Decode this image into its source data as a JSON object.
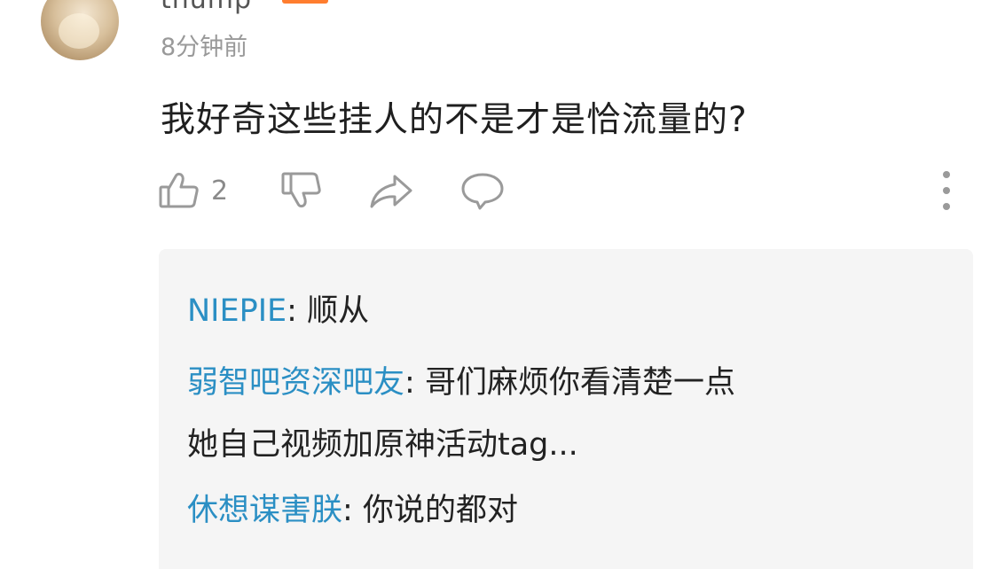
{
  "comment": {
    "username": "thump",
    "timestamp": "8分钟前",
    "text": "我好奇这些挂人的不是才是恰流量的?",
    "like_count": "2",
    "badge_color": "#ff7d2f"
  },
  "actions": {
    "like_icon": "thumbs-up-icon",
    "dislike_icon": "thumbs-down-icon",
    "share_icon": "share-icon",
    "reply_icon": "comment-bubble-icon",
    "more_icon": "more-vertical-icon"
  },
  "replies": [
    {
      "author": "NIEPIE",
      "sep": ":",
      "text": " 顺从"
    },
    {
      "author": "弱智吧资深吧友",
      "sep": ":",
      "text": " 哥们麻烦你看清楚一点",
      "text_line2": "她自己视频加原神活动tag..."
    },
    {
      "author": "休想谋害朕",
      "sep": ":",
      "text": " 你说的都对"
    }
  ],
  "colors": {
    "reply_author": "#2b8fc4",
    "reply_background": "#f5f5f5",
    "icon_gray": "#9a9a9a"
  }
}
